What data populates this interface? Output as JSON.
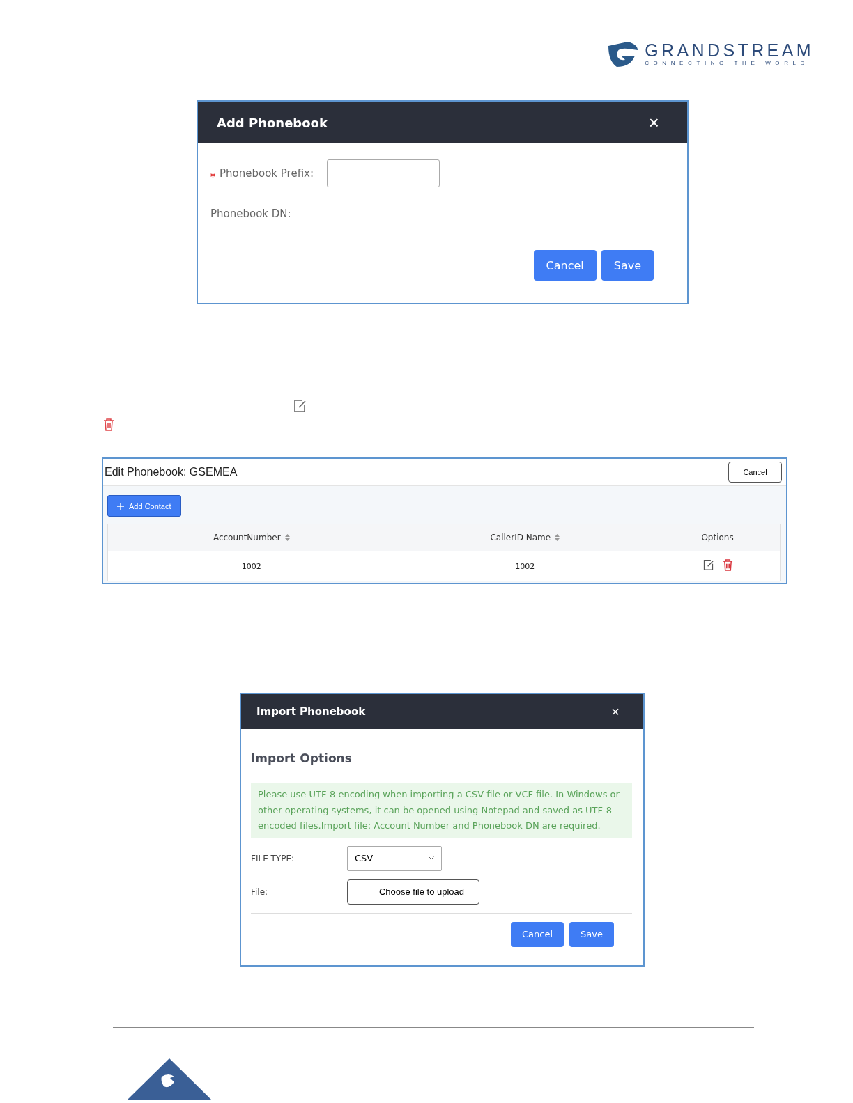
{
  "header": {
    "logo_name": "GRANDSTREAM",
    "logo_tagline": "CONNECTING THE WORLD"
  },
  "add_dialog": {
    "title": "Add Phonebook",
    "close": "×",
    "fields": [
      {
        "label": "Phonebook Prefix:",
        "required": true,
        "kind": "input"
      },
      {
        "label": "Phonebook DN:",
        "required": false,
        "kind": "text"
      }
    ],
    "buttons": [
      "Cancel",
      "Save"
    ]
  },
  "edit_panel": {
    "title": "Edit Phonebook: GSEMEA",
    "cancel": "Cancel",
    "add_contact": "Add Contact",
    "columns": [
      {
        "label": "AccountNumber",
        "sortable": true
      },
      {
        "label": "CallerID Name",
        "sortable": true
      },
      {
        "label": "Options",
        "sortable": false
      }
    ],
    "rows": [
      {
        "cells": [
          "1002",
          "1002"
        ]
      }
    ]
  },
  "import_dialog": {
    "title": "Import Phonebook",
    "close": "×",
    "section": "Import Options",
    "notice": "Please use UTF-8 encoding when importing a CSV file or VCF file. In Windows or other operating systems, it can be opened using Notepad and saved as UTF-8 encoded files.Import file: Account Number and Phonebook DN are required.",
    "file_type_label": "FILE TYPE:",
    "file_type_value": "CSV",
    "file_label": "File:",
    "file_button": "Choose file to upload",
    "buttons": [
      "Cancel",
      "Save"
    ]
  }
}
